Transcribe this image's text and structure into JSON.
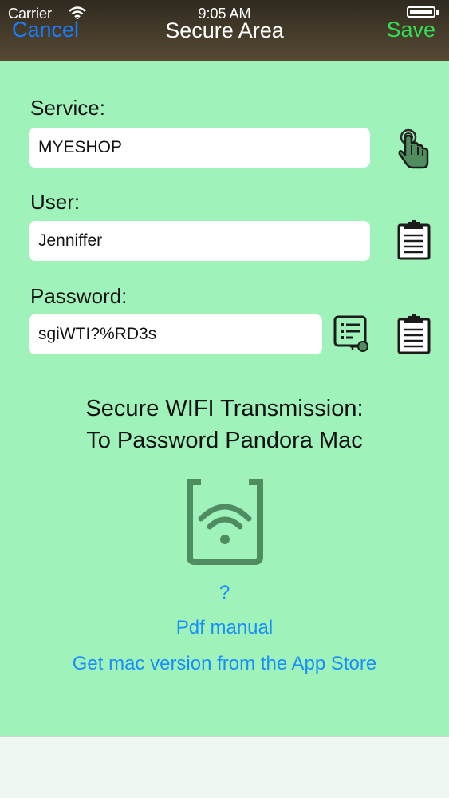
{
  "status_bar": {
    "carrier": "Carrier",
    "time": "9:05 AM"
  },
  "nav": {
    "cancel": "Cancel",
    "title": "Secure Area",
    "save": "Save"
  },
  "form": {
    "service_label": "Service:",
    "service_value": "MYESHOP",
    "user_label": "User:",
    "user_value": "Jenniffer",
    "password_label": "Password:",
    "password_value": "sgiWTI?%RD3s"
  },
  "transmission": {
    "line1": "Secure WIFI Transmission:",
    "line2": "To Password Pandora Mac"
  },
  "links": {
    "help": "?",
    "pdf_manual": "Pdf manual",
    "app_store": "Get mac version from the App Store"
  },
  "icons": {
    "service_action": "hand-pointer-icon",
    "user_action": "clipboard-icon",
    "password_generate": "password-list-key-icon",
    "password_action": "clipboard-icon",
    "transmit": "wifi-device-icon"
  },
  "colors": {
    "background": "#a0f2bb",
    "nav_bar": "#4a3f2c",
    "cancel": "#1a7cff",
    "save": "#33dd55",
    "link": "#1a8ef8",
    "icon_dark": "#1b1b1b",
    "wifi_icon": "#4f8c60"
  }
}
